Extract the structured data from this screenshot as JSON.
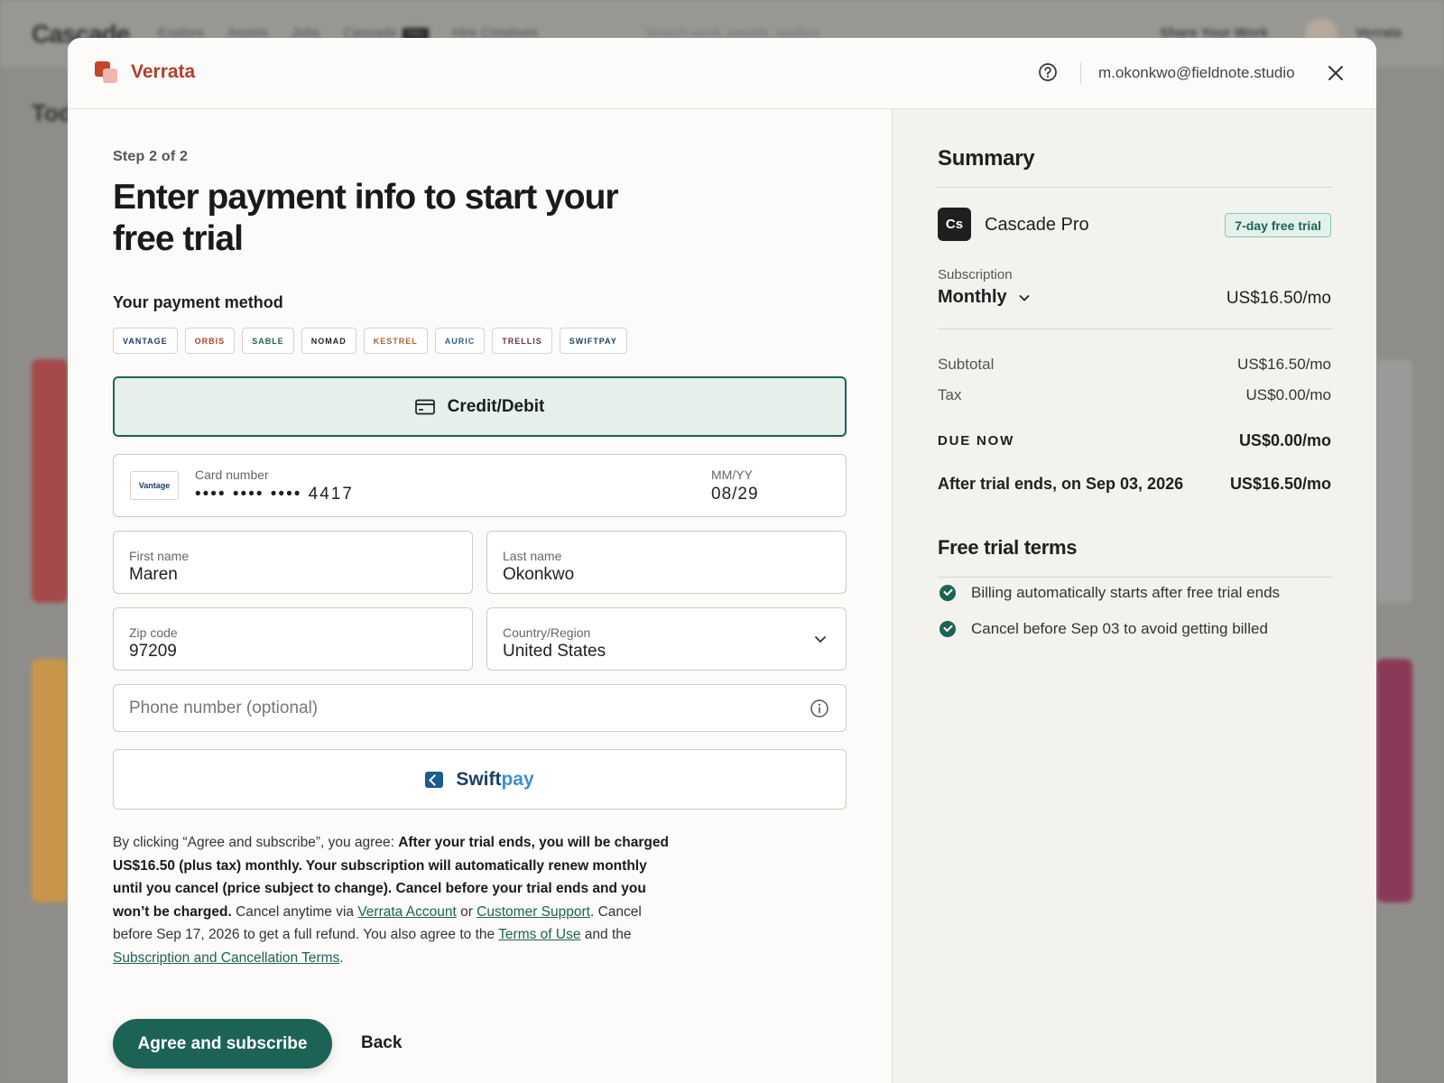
{
  "background": {
    "logo": "Cascade",
    "nav": [
      "Explore",
      "Assets",
      "Jobs",
      "Cascade",
      "Hire Creatives"
    ],
    "nav_badge": "PRO",
    "search_placeholder": "Search work, people, studios",
    "share": "Share Your Work",
    "user": "Verrata",
    "heading": "Tod"
  },
  "header": {
    "brand": "Verrata",
    "email": "m.okonkwo@fieldnote.studio",
    "help_icon": "help-circle-icon",
    "close_icon": "close-icon"
  },
  "form": {
    "step": "Step 2 of 2",
    "title": "Enter payment info to start your free trial",
    "payment_method_label": "Your payment method",
    "card_brands": [
      {
        "name": "VANTAGE",
        "color": "#1d3a6b"
      },
      {
        "name": "ORBIS",
        "color": "#b23f2b"
      },
      {
        "name": "SABLE",
        "color": "#1d6355"
      },
      {
        "name": "NOMAD",
        "color": "#222222"
      },
      {
        "name": "KESTREL",
        "color": "#a8642a"
      },
      {
        "name": "AURIC",
        "color": "#2f5f8a"
      },
      {
        "name": "TRELLIS",
        "color": "#6b2f55"
      },
      {
        "name": "SWIFTPAY",
        "color": "#1c3f66"
      }
    ],
    "credit_debit_label": "Credit/Debit",
    "card_logo": "Vantage",
    "card_number_label": "Card number",
    "card_number": "•••• •••• •••• 4417",
    "expiry_label": "MM/YY",
    "expiry": "08/29",
    "first_name_label": "First name",
    "first_name": "Maren",
    "last_name_label": "Last name",
    "last_name": "Okonkwo",
    "zip_label": "Zip code",
    "zip": "97209",
    "country_label": "Country/Region",
    "country": "United States",
    "phone_placeholder": "Phone number (optional)",
    "swiftpay_a": "Swift",
    "swiftpay_b": "pay"
  },
  "legal": {
    "intro": "By clicking “Agree and subscribe”, you agree: ",
    "bold": "After your trial ends, you will be charged US$16.50 (plus tax) monthly. Your subscription will automatically renew monthly until you cancel (price subject to change). Cancel before your trial ends and you won’t be charged.",
    "t1": " Cancel anytime via ",
    "link_account": "Verrata Account",
    "t2": " or ",
    "link_support": "Customer Support",
    "t3": ". Cancel before Sep 17, 2026 to get a full refund. You also agree to the ",
    "link_terms": "Terms of Use",
    "t4": " and the ",
    "link_sub_terms": "Subscription and Cancellation Terms",
    "t5": "."
  },
  "actions": {
    "agree": "Agree and subscribe",
    "back": "Back"
  },
  "summary": {
    "title": "Summary",
    "product_icon": "Cs",
    "product_name": "Cascade Pro",
    "trial_badge": "7-day free trial",
    "subscription_label": "Subscription",
    "subscription_value": "Monthly",
    "subscription_price": "US$16.50/mo",
    "subtotal_label": "Subtotal",
    "subtotal": "US$16.50/mo",
    "tax_label": "Tax",
    "tax": "US$0.00/mo",
    "due_label": "DUE NOW",
    "due": "US$0.00/mo",
    "after_label": "After trial ends, on Sep 03, 2026",
    "after": "US$16.50/mo",
    "terms_title": "Free trial terms",
    "terms": [
      "Billing automatically starts after free trial ends",
      "Cancel before Sep 03 to avoid getting billed"
    ]
  },
  "colors": {
    "accent": "#1d6355",
    "brand": "#b23f2b",
    "overlay": "#8f8d8a"
  }
}
